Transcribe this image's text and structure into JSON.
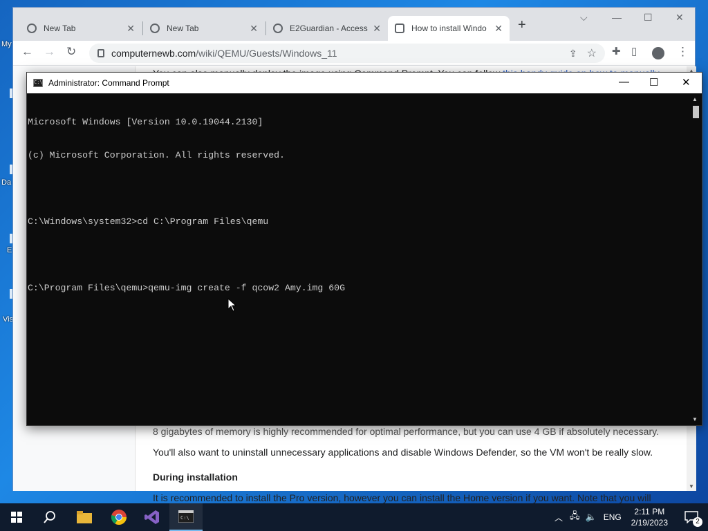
{
  "desktop": {
    "labels": [
      "My",
      "Da",
      "E",
      "Vis"
    ]
  },
  "browser": {
    "tabs": [
      {
        "title": "New Tab",
        "icon": "chrome-icon"
      },
      {
        "title": "New Tab",
        "icon": "chrome-icon"
      },
      {
        "title": "E2Guardian - Access",
        "icon": "globe-icon"
      },
      {
        "title": "How to install Windo",
        "icon": "wiki-icon"
      }
    ],
    "new_tab_symbol": "+",
    "window_controls": {
      "dropdown": "⌵",
      "minimize": "—",
      "maximize": "☐",
      "close": "✕"
    },
    "url_host": "computernewb.com",
    "url_path": "/wiki/QEMU/Guests/Windows_11",
    "page": {
      "line1_text": "You can also manually deploy the image using Command Prompt. You can follow ",
      "line1_link": "this handy guide on how to manually",
      "line2_text": "8 gigabytes of memory is highly recommended for optimal performance, but you can use 4 GB if absolutely necessary.",
      "line3_text": "You'll also want to uninstall unnecessary applications and disable Windows Defender, so the VM won't be really slow.",
      "heading": "During installation",
      "line4_text": "It is recommended to install the Pro version, however you can install the Home version if you want. Note that you will"
    }
  },
  "cmd": {
    "title": "Administrator:  Command Prompt",
    "icon_text": "C:\\",
    "controls": {
      "minimize": "—",
      "maximize": "☐",
      "close": "✕"
    },
    "lines": [
      "Microsoft Windows [Version 10.0.19044.2130]",
      "(c) Microsoft Corporation. All rights reserved.",
      "",
      "C:\\Windows\\system32>cd C:\\Program Files\\qemu",
      "",
      "C:\\Program Files\\qemu>qemu-img create -f qcow2 Amy.img 60G"
    ]
  },
  "taskbar": {
    "apps": [
      "start-icon",
      "search-icon",
      "file-explorer-icon",
      "chrome-icon",
      "visual-studio-icon",
      "command-prompt-icon"
    ],
    "tray_language": "ENG",
    "time": "2:11 PM",
    "date": "2/19/2023",
    "notification_count": "2"
  },
  "colors": {
    "console_bg": "#0c0c0c",
    "console_fg": "#cccccc",
    "taskbar_bg": "#0f1b2d",
    "link": "#3366cc"
  }
}
